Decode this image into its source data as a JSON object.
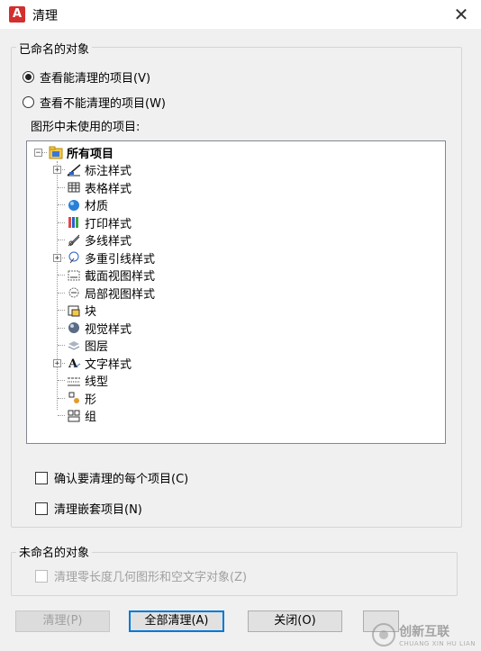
{
  "window": {
    "title": "清理"
  },
  "named_objects": {
    "group_label": "已命名的对象",
    "option_can_purge": "查看能清理的项目(V)",
    "option_cannot_purge": "查看不能清理的项目(W)",
    "selected_option": "can_purge",
    "tree_caption": "图形中未使用的项目:",
    "tree": {
      "root_label": "所有项目",
      "items": [
        {
          "label": "标注样式",
          "icon": "dimension-style-icon",
          "expandable": true
        },
        {
          "label": "表格样式",
          "icon": "table-style-icon",
          "expandable": false
        },
        {
          "label": "材质",
          "icon": "material-icon",
          "expandable": false
        },
        {
          "label": "打印样式",
          "icon": "plot-style-icon",
          "expandable": false
        },
        {
          "label": "多线样式",
          "icon": "multiline-style-icon",
          "expandable": false
        },
        {
          "label": "多重引线样式",
          "icon": "multileader-style-icon",
          "expandable": true
        },
        {
          "label": "截面视图样式",
          "icon": "section-view-style-icon",
          "expandable": false
        },
        {
          "label": "局部视图样式",
          "icon": "detail-view-style-icon",
          "expandable": false
        },
        {
          "label": "块",
          "icon": "block-icon",
          "expandable": false
        },
        {
          "label": "视觉样式",
          "icon": "visual-style-icon",
          "expandable": false
        },
        {
          "label": "图层",
          "icon": "layer-icon",
          "expandable": false
        },
        {
          "label": "文字样式",
          "icon": "text-style-icon",
          "expandable": true
        },
        {
          "label": "线型",
          "icon": "linetype-icon",
          "expandable": false
        },
        {
          "label": "形",
          "icon": "shape-icon",
          "expandable": false
        },
        {
          "label": "组",
          "icon": "group-icon",
          "expandable": false
        }
      ]
    },
    "confirm_each_label": "确认要清理的每个项目(C)",
    "purge_nested_label": "清理嵌套项目(N)"
  },
  "unnamed_objects": {
    "group_label": "未命名的对象",
    "purge_zero_length_label": "清理零长度几何图形和空文字对象(Z)"
  },
  "buttons": {
    "purge": "清理(P)",
    "purge_all": "全部清理(A)",
    "close": "关闭(O)"
  },
  "watermark": {
    "name": "创新互联",
    "sub": "CHUANG XIN HU LIAN"
  },
  "colors": {
    "accent_focus": "#0078d7",
    "autocad_red": "#d32f2f"
  }
}
